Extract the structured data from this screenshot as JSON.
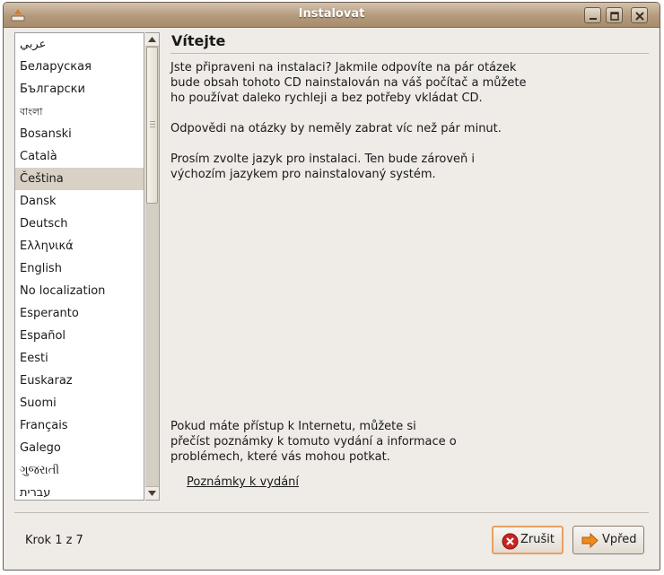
{
  "window": {
    "title": "Instalovat",
    "controls": [
      "minimize-icon",
      "maximize-icon",
      "close-icon"
    ]
  },
  "languages": {
    "items": [
      "عربي",
      "Беларуская",
      "Български",
      "বাংলা",
      "Bosanski",
      "Català",
      "Čeština",
      "Dansk",
      "Deutsch",
      "Ελληνικά",
      "English",
      "No localization",
      "Esperanto",
      "Español",
      "Eesti",
      "Euskaraz",
      "Suomi",
      "Français",
      "Galego",
      "ગુજરાતી",
      "עברית"
    ],
    "selected": "Čeština"
  },
  "content": {
    "heading": "Vítejte",
    "p1_line1": "Jste připraveni na instalaci? Jakmile odpovíte na pár otázek",
    "p1_line2": "bude obsah tohoto CD nainstalován na váš počítač a můžete",
    "p1_line3": "ho používat daleko rychleji a bez potřeby vkládat CD.",
    "p2": "Odpovědi na otázky by neměly zabrat víc než pár minut.",
    "p3_line1": "Prosím zvolte jazyk pro instalaci. Ten bude zároveň i",
    "p3_line2": "výchozím jazykem pro nainstalovaný systém.",
    "p4_line1": "Pokud máte přístup k Internetu, můžete si",
    "p4_line2": "přečíst poznámky k tomuto vydání a informace o",
    "p4_line3": "problémech, které vás mohou potkat.",
    "release_notes_link": "Poznámky k vydání"
  },
  "footer": {
    "step": "Krok 1 z 7",
    "cancel_label": "Zrušit",
    "next_label": "Vpřed"
  },
  "colors": {
    "title_bar": "#b49a7c",
    "selection": "#d9d1c5",
    "cancel_focus": "#e8a060",
    "cancel_icon": "#cc2222",
    "next_icon": "#f08a1c"
  }
}
